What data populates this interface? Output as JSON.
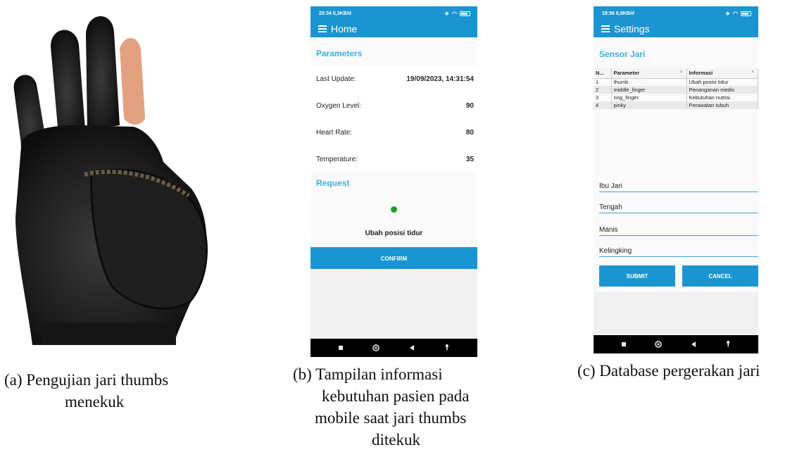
{
  "captions": {
    "a": [
      "(a)  Pengujian jari thumbs",
      "menekuk"
    ],
    "b": [
      "(b)  Tampilan informasi",
      "kebutuhan pasien pada",
      "mobile saat jari thumbs",
      "ditekuk"
    ],
    "c": [
      "(c)  Database pergerakan jari"
    ]
  },
  "home": {
    "status_time": "20:34",
    "status_data": "0,3KB/d",
    "app_title": "Home",
    "parameters_heading": "Parameters",
    "rows": [
      {
        "label": "Last Update:",
        "value": "19/09/2023, 14:31:54"
      },
      {
        "label": "Oxygen Level:",
        "value": "90"
      },
      {
        "label": "Heart Rate:",
        "value": "80"
      },
      {
        "label": "Temperature:",
        "value": "35"
      }
    ],
    "request_heading": "Request",
    "request_status_color": "#1a9f2a",
    "request_text": "Ubah posisi tidur",
    "confirm_label": "CONFIRM"
  },
  "settings": {
    "status_time": "19:56",
    "status_data": "6,9KB/d",
    "app_title": "Settings",
    "table_heading": "Sensor Jari",
    "columns": [
      "N...",
      "Parameter",
      "Informasi"
    ],
    "rows": [
      [
        "1",
        "thumb",
        "Ubah posisi tidur"
      ],
      [
        "2",
        "middle_finger",
        "Penanganan medis"
      ],
      [
        "3",
        "ring_finger",
        "Kebutuhan nutrisi"
      ],
      [
        "4",
        "pinky",
        "Perawatan tubuh"
      ]
    ],
    "inputs": [
      "Ibu Jari",
      "Tengah",
      "Manis",
      "Kelingking"
    ],
    "submit_label": "SUBMIT",
    "cancel_label": "CANCEL"
  },
  "colors": {
    "accent": "#1b95d1",
    "heading": "#39b1e0",
    "nav_bar": "#000000"
  },
  "icons": {
    "menu": "hamburger-icon",
    "nav": [
      "recent-apps-icon",
      "home-icon",
      "back-icon",
      "accessibility-icon"
    ]
  }
}
